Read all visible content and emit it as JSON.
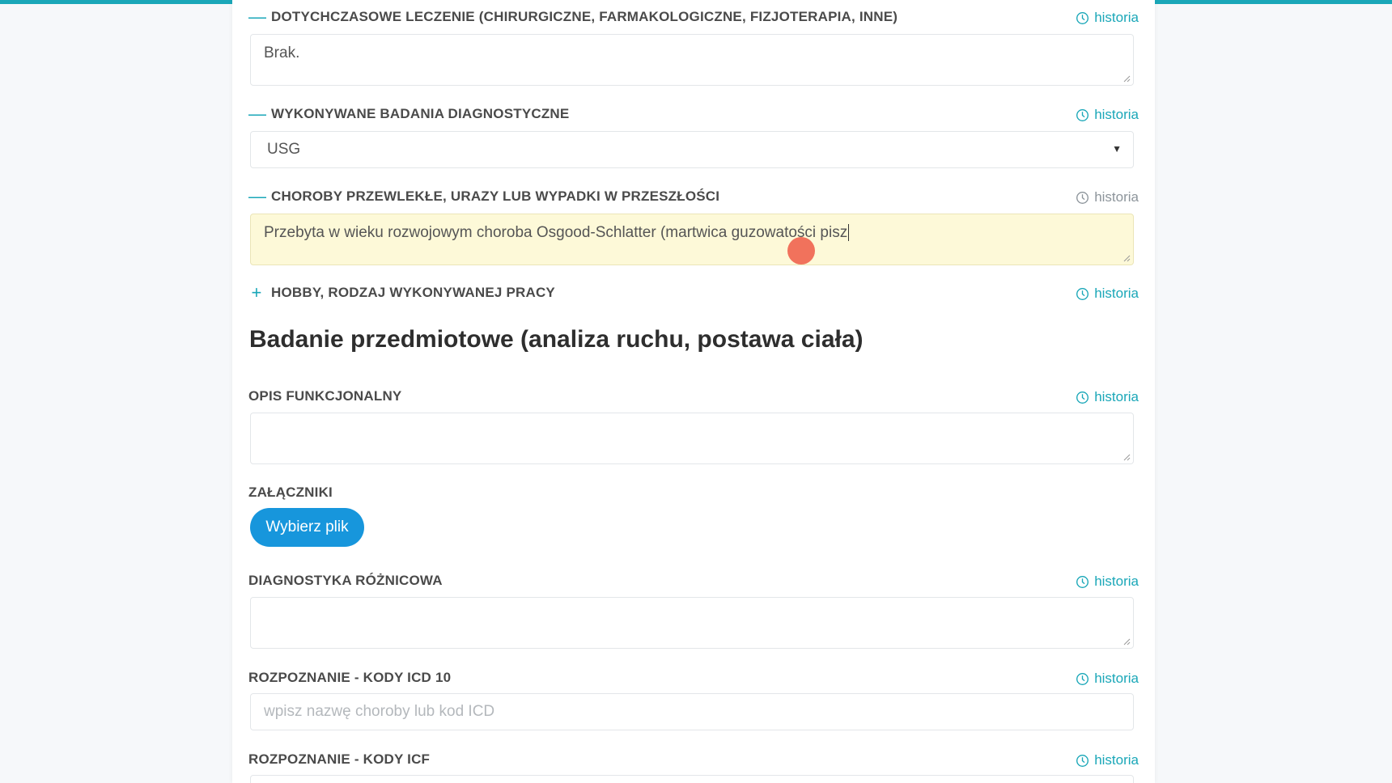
{
  "sections": [
    {
      "label": "DOTYCHCZASOWE LECZENIE (CHIRURGICZNE, FARMAKOLOGICZNE, FIZJOTERAPIA, INNE)",
      "toggle": "—",
      "history": "historia",
      "value": "Brak."
    },
    {
      "label": "WYKONYWANE BADANIA DIAGNOSTYCZNE",
      "toggle": "—",
      "history": "historia",
      "value": "USG"
    },
    {
      "label": "CHOROBY PRZEWLEKŁE, URAZY LUB WYPADKI W PRZESZŁOŚCI",
      "toggle": "—",
      "history": "historia",
      "value": "Przebyta w wieku rozwojowym choroba Osgood-Schlatter (martwica guzowatości pisz"
    },
    {
      "label": "HOBBY, RODZAJ WYKONYWANEJ PRACY",
      "toggle": "+",
      "history": "historia"
    }
  ],
  "heading": "Badanie przedmiotowe (analiza ruchu, postawa ciała)",
  "functional": {
    "label": "OPIS FUNKCJONALNY",
    "history": "historia",
    "value": ""
  },
  "attachments": {
    "label": "ZAŁĄCZNIKI",
    "button": "Wybierz plik"
  },
  "differential": {
    "label": "DIAGNOSTYKA RÓŻNICOWA",
    "history": "historia",
    "value": ""
  },
  "icd10": {
    "label": "ROZPOZNANIE - KODY ICD 10",
    "history": "historia",
    "placeholder": "wpisz nazwę choroby lub kod ICD"
  },
  "icf": {
    "label": "ROZPOZNANIE - KODY ICF",
    "history": "historia"
  },
  "colors": {
    "accent": "#1aa7b8",
    "button": "#1796dc",
    "active_field": "#fdf9d8"
  }
}
